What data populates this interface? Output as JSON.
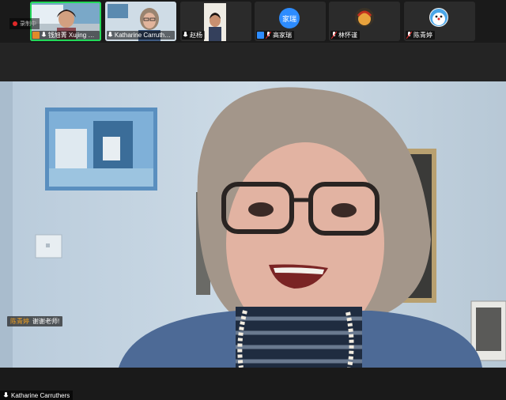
{
  "recording": {
    "label": "录制中"
  },
  "participants": [
    {
      "name": "钱旭菁 Xujing Q...",
      "muted": false,
      "host": true
    },
    {
      "name": "Katharine Carruthers",
      "muted": false,
      "host": false
    },
    {
      "name": "赵杨",
      "muted": false,
      "host": false
    },
    {
      "name": "高家瑞",
      "muted": true,
      "host": false,
      "avatar_text": "家瑞",
      "avatar_color": "#2d8cff"
    },
    {
      "name": "林怀谨",
      "muted": true,
      "host": false
    },
    {
      "name": "陈青婷",
      "muted": true,
      "host": false
    }
  ],
  "chat": {
    "sender": "陈青婷",
    "message": "谢谢老师!"
  },
  "active_speaker": {
    "name": "Katharine Carruthers"
  },
  "colors": {
    "active_border": "#23d959",
    "accent": "#2d8cff"
  }
}
